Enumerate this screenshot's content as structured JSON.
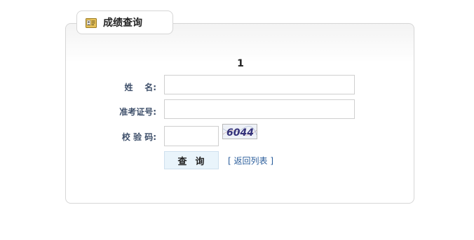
{
  "panel": {
    "title": "成绩查询",
    "icon": "id-card-icon"
  },
  "form": {
    "heading": "1",
    "name_label": "姓    名:",
    "name_value": "",
    "exam_id_label": "准考证号:",
    "exam_id_value": "",
    "captcha_label": "校 验 码:",
    "captcha_value": "",
    "captcha_text": "6044"
  },
  "actions": {
    "query_label": "查  询",
    "back_bracket_open": "[",
    "back_label": "返回列表",
    "back_bracket_close": "]"
  },
  "colors": {
    "label": "#3e4f6a",
    "link": "#2a5d9b",
    "button_bg": "#e9f4fb",
    "border": "#d6d6d6"
  }
}
